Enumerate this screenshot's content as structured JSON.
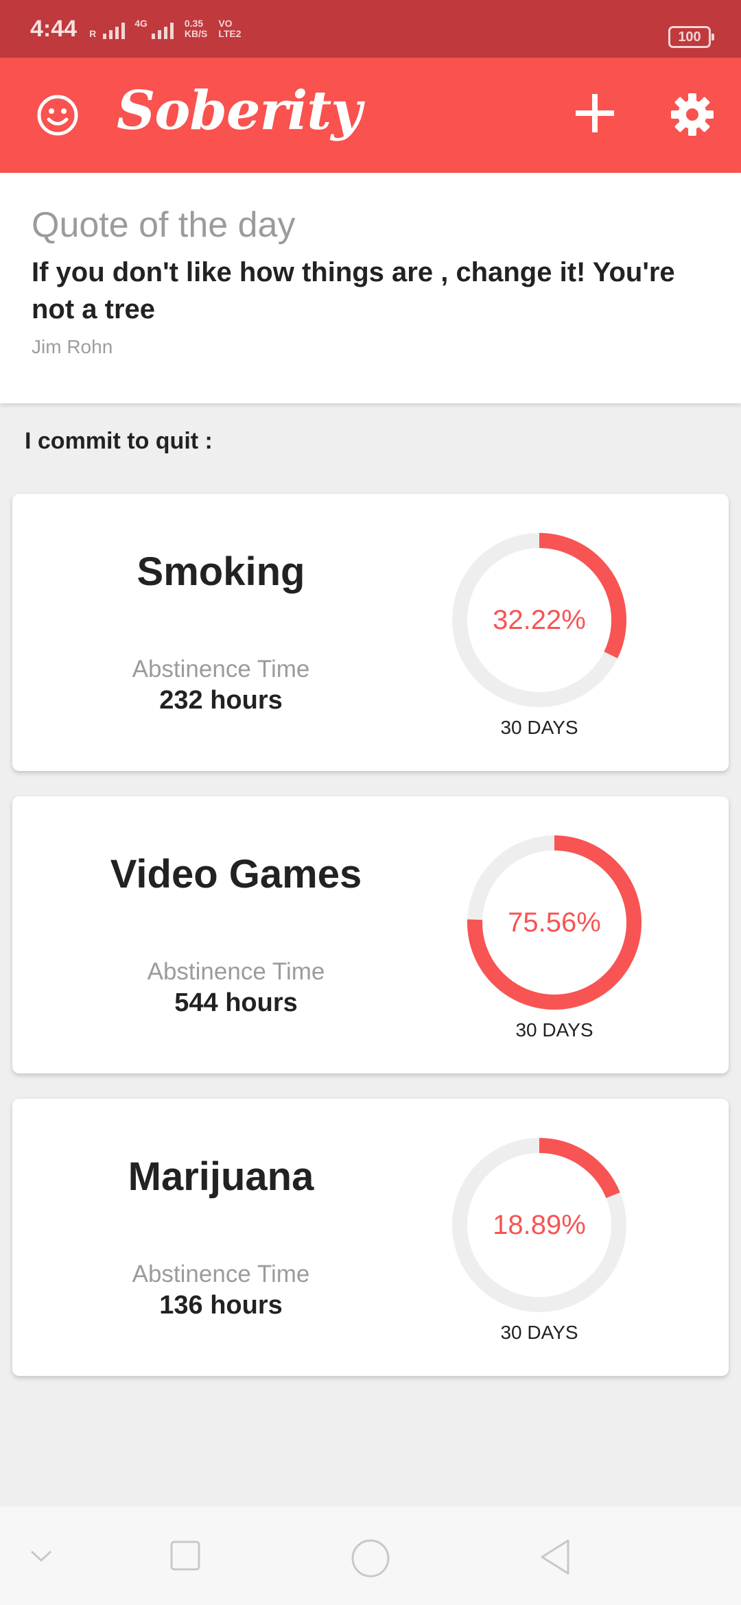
{
  "status_bar": {
    "time": "4:44",
    "roaming": "R",
    "network_type": "4G",
    "speed_value": "0.35",
    "speed_unit": "KB/S",
    "volte_top": "VO",
    "volte_bottom": "LTE2",
    "battery": "100"
  },
  "app_bar": {
    "title": "Soberity",
    "icons": [
      "smiley-icon",
      "plus-icon",
      "gear-icon"
    ],
    "background": "#f9524f"
  },
  "quote": {
    "heading": "Quote of the day",
    "text": "If you don't like how things are , change it! You're not a tree",
    "author": "Jim Rohn"
  },
  "commit_label": "I commit to quit :",
  "habits": [
    {
      "name": "Smoking",
      "abstinence_label": "Abstinence Time",
      "abstinence_value": "232 hours",
      "percent_text": "32.22%",
      "percent": 32.22,
      "goal_label": "30 DAYS"
    },
    {
      "name": "Video Games",
      "abstinence_label": "Abstinence Time",
      "abstinence_value": "544 hours",
      "percent_text": "75.56%",
      "percent": 75.56,
      "goal_label": "30 DAYS"
    },
    {
      "name": "Marijuana",
      "abstinence_label": "Abstinence Time",
      "abstinence_value": "136 hours",
      "percent_text": "18.89%",
      "percent": 18.89,
      "goal_label": "30 DAYS"
    }
  ],
  "colors": {
    "accent": "#f9524f",
    "status_bar": "#c0393d",
    "ring_track": "#eeeeee",
    "ring_fill": "#f75453"
  },
  "nav_bar": {
    "icons": [
      "chevron-down-icon",
      "square-icon",
      "circle-icon",
      "triangle-back-icon"
    ]
  }
}
